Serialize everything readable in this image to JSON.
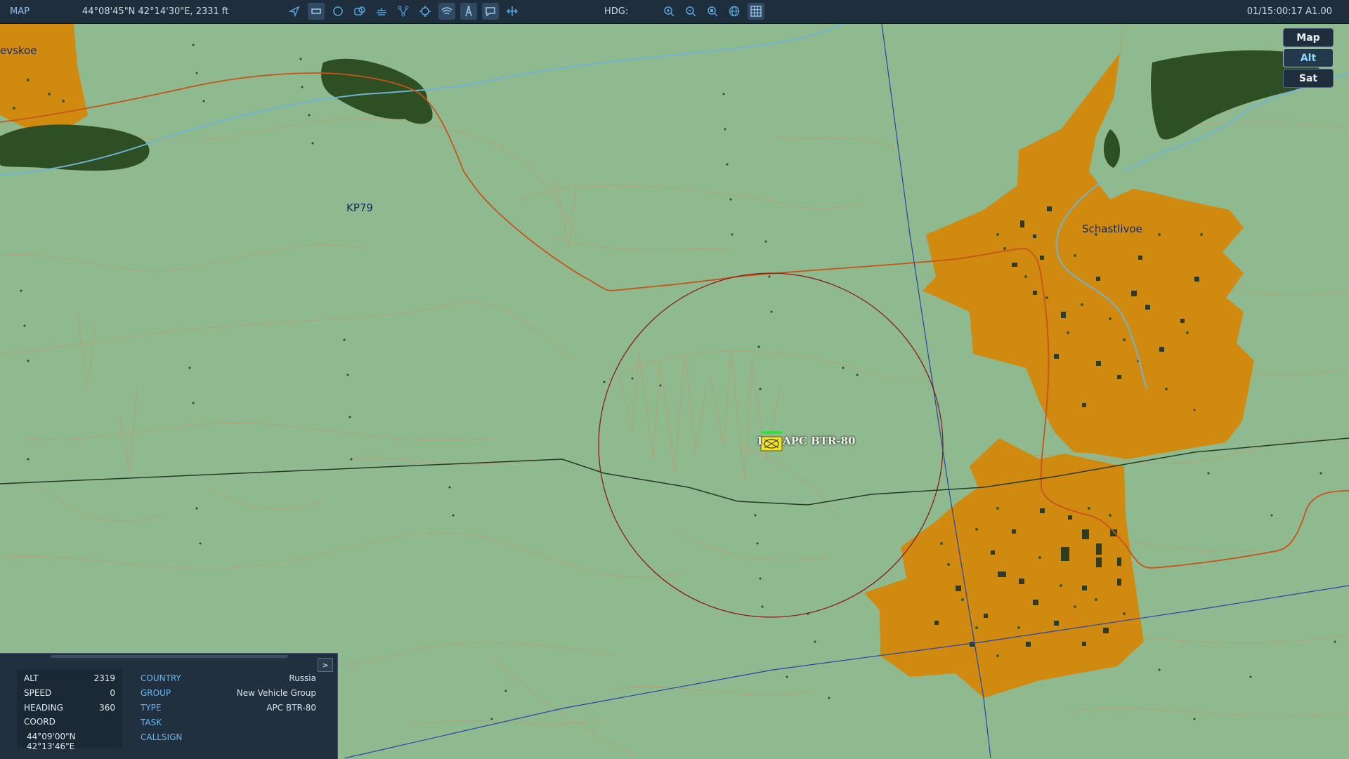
{
  "topbar": {
    "title": "MAP",
    "coords": "44°08'45\"N 42°14'30\"E, 2331 ft",
    "hdg_label": "HDG:",
    "time": "01/15:00:17 A1.00"
  },
  "map_layers": [
    "Map",
    "Alt",
    "Sat"
  ],
  "map_labels": {
    "village_left": "evskoe",
    "grid_square": "KP79",
    "village_right": "Schastlivoe"
  },
  "unit": {
    "label": "APC BTR-80",
    "index": "1"
  },
  "info_panel": {
    "expand": ">",
    "left": [
      {
        "k": "ALT",
        "v": "2319"
      },
      {
        "k": "SPEED",
        "v": "0"
      },
      {
        "k": "HEADING",
        "v": "360"
      },
      {
        "k": "COORD",
        "v": ""
      }
    ],
    "coord_value": "44°09'00\"N 42°13'46\"E",
    "right": [
      {
        "k": "COUNTRY",
        "v": "Russia"
      },
      {
        "k": "GROUP",
        "v": "New Vehicle Group"
      },
      {
        "k": "TYPE",
        "v": "APC BTR-80"
      },
      {
        "k": "TASK",
        "v": ""
      },
      {
        "k": "CALLSIGN",
        "v": ""
      }
    ]
  },
  "colors": {
    "terrain": "#8fba8f",
    "town": "#d08a10",
    "forest": "#2e4f24",
    "river": "#6fb4d2",
    "road": "#c6541a",
    "panel": "#21303f",
    "accent": "#66b6f0"
  },
  "icons": [
    "pointer-icon",
    "rectangle-icon",
    "circle-icon",
    "layers-icon",
    "ship-icon",
    "route-icon",
    "target-icon",
    "signal-icon",
    "tower-icon",
    "chat-icon",
    "ruler-icon",
    "zoom-in-icon",
    "zoom-out-icon",
    "zoom-fit-icon",
    "globe-icon",
    "grid-icon"
  ]
}
